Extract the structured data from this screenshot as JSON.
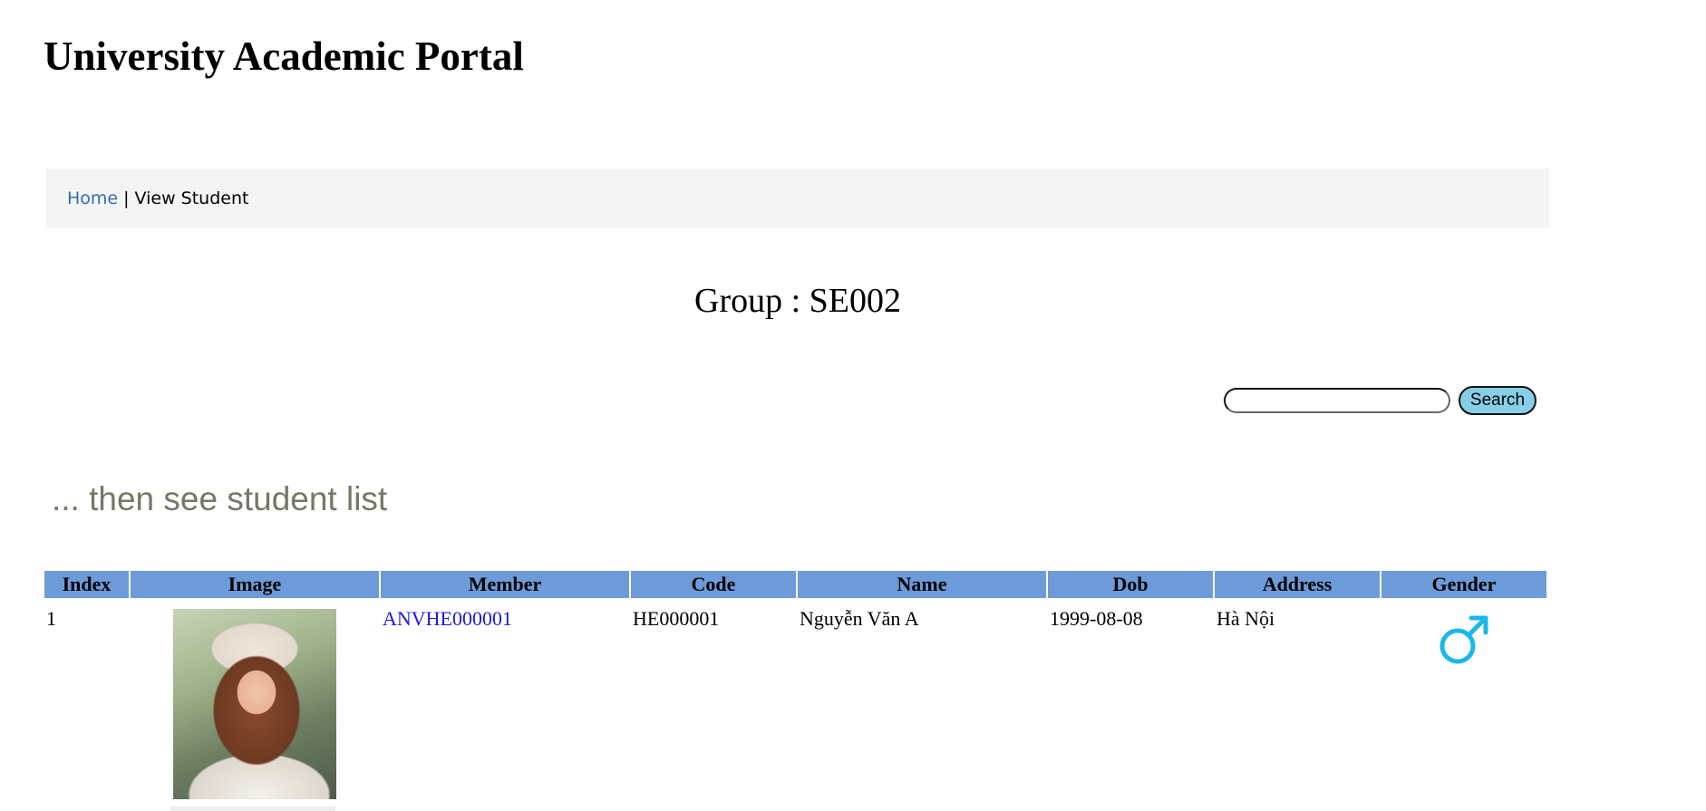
{
  "header": {
    "title": "University Academic Portal"
  },
  "breadcrumb": {
    "home": "Home",
    "separator": "|",
    "current": "View Student"
  },
  "group": {
    "heading": "Group : SE002"
  },
  "search": {
    "value": "",
    "placeholder": "",
    "button_label": "Search"
  },
  "subtitle": "... then see student list",
  "table": {
    "columns": [
      "Index",
      "Image",
      "Member",
      "Code",
      "Name",
      "Dob",
      "Address",
      "Gender"
    ],
    "rows": [
      {
        "index": "1",
        "image": "student-photo",
        "member": "ANVHE000001",
        "code": "HE000001",
        "name": "Nguyễn Văn A",
        "dob": "1999-08-08",
        "address": "Hà Nội",
        "gender": "male-symbol-icon"
      }
    ]
  },
  "colors": {
    "header_bg": "#6d9ad8",
    "link": "#1a1adf",
    "breadcrumb_link": "#2f6db5",
    "search_button_bg": "#87cfe8",
    "gender_male": "#1cb7ea",
    "subtitle": "#777766"
  }
}
